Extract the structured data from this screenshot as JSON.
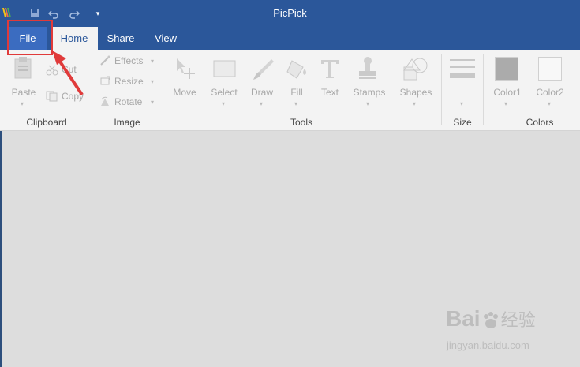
{
  "app": {
    "title": "PicPick"
  },
  "quick_access": {
    "icons": [
      "save-icon",
      "undo-icon",
      "redo-icon",
      "customize-dropdown-icon"
    ]
  },
  "tabs": [
    {
      "label": "File",
      "state": "highlighted"
    },
    {
      "label": "Home",
      "state": "active"
    },
    {
      "label": "Share"
    },
    {
      "label": "View"
    }
  ],
  "ribbon": {
    "clipboard": {
      "label": "Clipboard",
      "paste": "Paste",
      "cut": "Cut",
      "copy": "Copy"
    },
    "image": {
      "label": "Image",
      "effects": "Effects",
      "resize": "Resize",
      "rotate": "Rotate"
    },
    "tools": {
      "label": "Tools",
      "move": "Move",
      "select": "Select",
      "draw": "Draw",
      "fill": "Fill",
      "text": "Text",
      "stamps": "Stamps",
      "shapes": "Shapes"
    },
    "size": {
      "label": "Size"
    },
    "colors": {
      "label": "Colors",
      "color1": "Color1",
      "color2": "Color2"
    }
  },
  "colors": {
    "titlebar": "#2b579a",
    "highlight": "#e03a3a"
  },
  "watermark": {
    "brand": "Bai",
    "brand2": "经验",
    "url": "jingyan.baidu.com"
  }
}
